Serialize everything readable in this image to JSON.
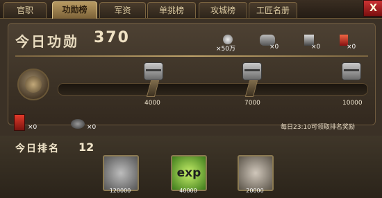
{
  "tabs": [
    "官职",
    "功勋榜",
    "军资",
    "单挑榜",
    "攻城榜",
    "工匠名册"
  ],
  "close_label": "X",
  "merit": {
    "title": "今日功勋",
    "value": "370",
    "rewards": [
      {
        "count": "×50万"
      },
      {
        "count": "×0"
      },
      {
        "count": "×0"
      },
      {
        "count": "×0"
      }
    ]
  },
  "milestones": [
    "4000",
    "7000",
    "10000"
  ],
  "claimed": {
    "flag": "×0",
    "stone": "×0"
  },
  "notice": "每日23:10可领取排名奖励",
  "rank": {
    "title": "今日排名",
    "value": "12",
    "exp_icon_text": "exp",
    "items": [
      "120000",
      "40000",
      "20000"
    ]
  }
}
